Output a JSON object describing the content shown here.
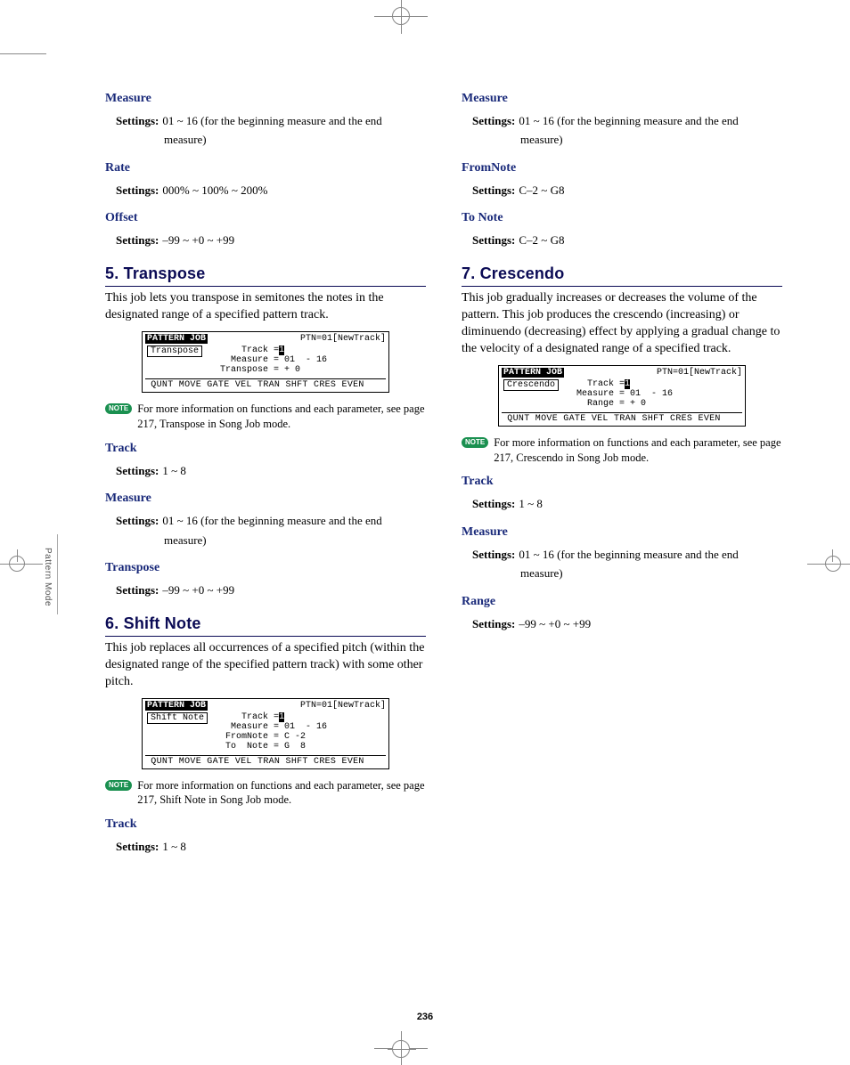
{
  "sideTab": "Pattern Mode",
  "pageNumber": "236",
  "noteBadge": "NOTE",
  "settingsLabel": "Settings:",
  "left": {
    "measure1": {
      "title": "Measure",
      "value": "01 ~ 16 (for the beginning measure and the end",
      "value2": "measure)"
    },
    "rate": {
      "title": "Rate",
      "value": "000% ~ 100% ~ 200%"
    },
    "offset": {
      "title": "Offset",
      "value": "–99 ~ +0 ~ +99"
    },
    "sec5": {
      "title": "5. Transpose",
      "body": "This job lets you transpose in semitones the notes in the designated range of a specified pattern track.",
      "lcd": {
        "topLeft": "PATTERN JOB",
        "topRight": "PTN=01[NewTrack]",
        "box": "Transpose",
        "p1": "    Track =",
        "p1b": "1",
        "p2": "  Measure = 01  - 16",
        "p3": "Transpose = + 0",
        "bottom": " QUNT MOVE GATE VEL TRAN SHFT CRES EVEN"
      },
      "note": "For more information on functions and each parameter, see page 217, Transpose in Song Job mode.",
      "track": {
        "title": "Track",
        "value": "1 ~ 8"
      },
      "measure": {
        "title": "Measure",
        "value": "01 ~ 16 (for the beginning measure and the end",
        "value2": "measure)"
      },
      "transpose": {
        "title": "Transpose",
        "value": "–99 ~ +0 ~ +99"
      }
    },
    "sec6": {
      "title": "6. Shift Note",
      "body": "This job replaces all occurrences of a specified pitch (within the designated range of the specified pattern track) with some other pitch.",
      "lcd": {
        "topLeft": "PATTERN JOB",
        "topRight": "PTN=01[NewTrack]",
        "box": "Shift Note",
        "p1": "   Track =",
        "p1b": "1",
        "p2": " Measure = 01  - 16",
        "p3": "FromNote = C -2",
        "p4": "To  Note = G  8",
        "bottom": " QUNT MOVE GATE VEL TRAN SHFT CRES EVEN"
      },
      "note": "For more information on functions and each parameter, see page 217, Shift Note in Song Job mode.",
      "track": {
        "title": "Track",
        "value": "1 ~ 8"
      }
    }
  },
  "right": {
    "measure1": {
      "title": "Measure",
      "value": "01 ~ 16 (for the beginning measure and the end",
      "value2": "measure)"
    },
    "fromnote": {
      "title": "FromNote",
      "value": "C–2 ~ G8"
    },
    "tonote": {
      "title": "To Note",
      "value": "C–2 ~ G8"
    },
    "sec7": {
      "title": "7. Crescendo",
      "body": "This job gradually increases or decreases the volume of the pattern. This job produces the crescendo (increasing) or diminuendo (decreasing) effect by applying a gradual change to the velocity of a designated range of a specified track.",
      "lcd": {
        "topLeft": "PATTERN JOB",
        "topRight": "PTN=01[NewTrack]",
        "box": "Crescendo",
        "p1": "  Track =",
        "p1b": "1",
        "p2": "Measure = 01  - 16",
        "p3": "  Range = + 0",
        "bottom": " QUNT MOVE GATE VEL TRAN SHFT CRES EVEN"
      },
      "note": "For more information on functions and each parameter, see page 217, Crescendo in Song Job mode.",
      "track": {
        "title": "Track",
        "value": "1 ~ 8"
      },
      "measure": {
        "title": "Measure",
        "value": "01 ~ 16 (for the beginning measure and the end",
        "value2": "measure)"
      },
      "range": {
        "title": "Range",
        "value": "–99 ~ +0 ~ +99"
      }
    }
  }
}
